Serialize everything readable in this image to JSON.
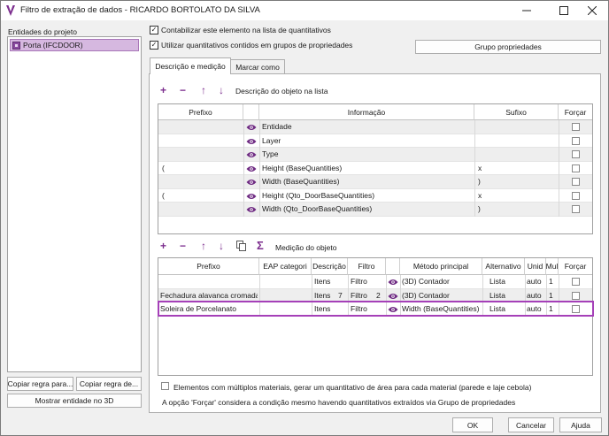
{
  "window": {
    "title": "Filtro de extração de dados - RICARDO BORTOLATO DA SILVA"
  },
  "left": {
    "label": "Entidades do projeto",
    "items": [
      {
        "label": "Porta (IFCDOOR)"
      }
    ],
    "copy_rule_1": "Copiar regra para...",
    "copy_rule_2": "Copiar regra de...",
    "show_3d": "Mostrar entidade no 3D"
  },
  "options": {
    "count_label": "Contabilizar este elemento na lista de quantitativos",
    "count_checked": true,
    "use_groups_label": "Utilizar quantitativos contidos em grupos de propriedades",
    "use_groups_checked": true,
    "group_button": "Grupo propriedades"
  },
  "tabs": [
    {
      "label": "Descrição e medição"
    },
    {
      "label": "Marcar como"
    }
  ],
  "description": {
    "toolbar_label": "Descrição do objeto na lista",
    "columns": [
      "Prefixo",
      "",
      "Informação",
      "Sufixo",
      "Forçar"
    ],
    "rows": [
      {
        "prefix": "",
        "info": "Entidade",
        "suffix": ""
      },
      {
        "prefix": "",
        "info": "Layer",
        "suffix": ""
      },
      {
        "prefix": "",
        "info": "Type",
        "suffix": ""
      },
      {
        "prefix": "(",
        "info": "Height (BaseQuantities)",
        "suffix": "x"
      },
      {
        "prefix": "",
        "info": "Width (BaseQuantities)",
        "suffix": ")"
      },
      {
        "prefix": "(",
        "info": "Height (Qto_DoorBaseQuantities)",
        "suffix": "x"
      },
      {
        "prefix": "",
        "info": "Width (Qto_DoorBaseQuantities)",
        "suffix": ")"
      }
    ]
  },
  "measurement": {
    "toolbar_label": "Medição do objeto",
    "columns": [
      "Prefixo",
      "EAP categori",
      "Descrição",
      "Filtro",
      "",
      "Método principal",
      "Alternativo",
      "Unid",
      "Mul",
      "Forçar"
    ],
    "rows": [
      {
        "prefix": "",
        "eap": "",
        "desc": "Itens",
        "desc_num": "",
        "filter": "Filtro",
        "filter_num": "",
        "method": "(3D) Contador",
        "alt": "Lista",
        "unit": "auto",
        "mul": "1"
      },
      {
        "prefix": "Fechadura alavanca cromada",
        "eap": "",
        "desc": "Itens",
        "desc_num": "7",
        "filter": "Filtro",
        "filter_num": "2",
        "method": "(3D) Contador",
        "alt": "Lista",
        "unit": "auto",
        "mul": "1"
      },
      {
        "prefix": "Soleira de Porcelanato",
        "eap": "",
        "desc": "Itens",
        "desc_num": "",
        "filter": "Filtro",
        "filter_num": "",
        "method": "Width (BaseQuantities)",
        "alt": "Lista",
        "unit": "auto",
        "mul": "1"
      }
    ]
  },
  "footer": {
    "multi_material_label": "Elementos com múltiplos materiais, gerar um quantitativo de área para cada material (parede e laje cebola)",
    "note": "A opção 'Forçar' considera a condição mesmo havendo quantitativos extraídos via Grupo de propriedades",
    "ok": "OK",
    "cancel": "Cancelar",
    "help": "Ajuda"
  },
  "colors": {
    "accent": "#7c2e8e",
    "selection": "#d6b8e0",
    "highlight_border": "#a540b8"
  }
}
